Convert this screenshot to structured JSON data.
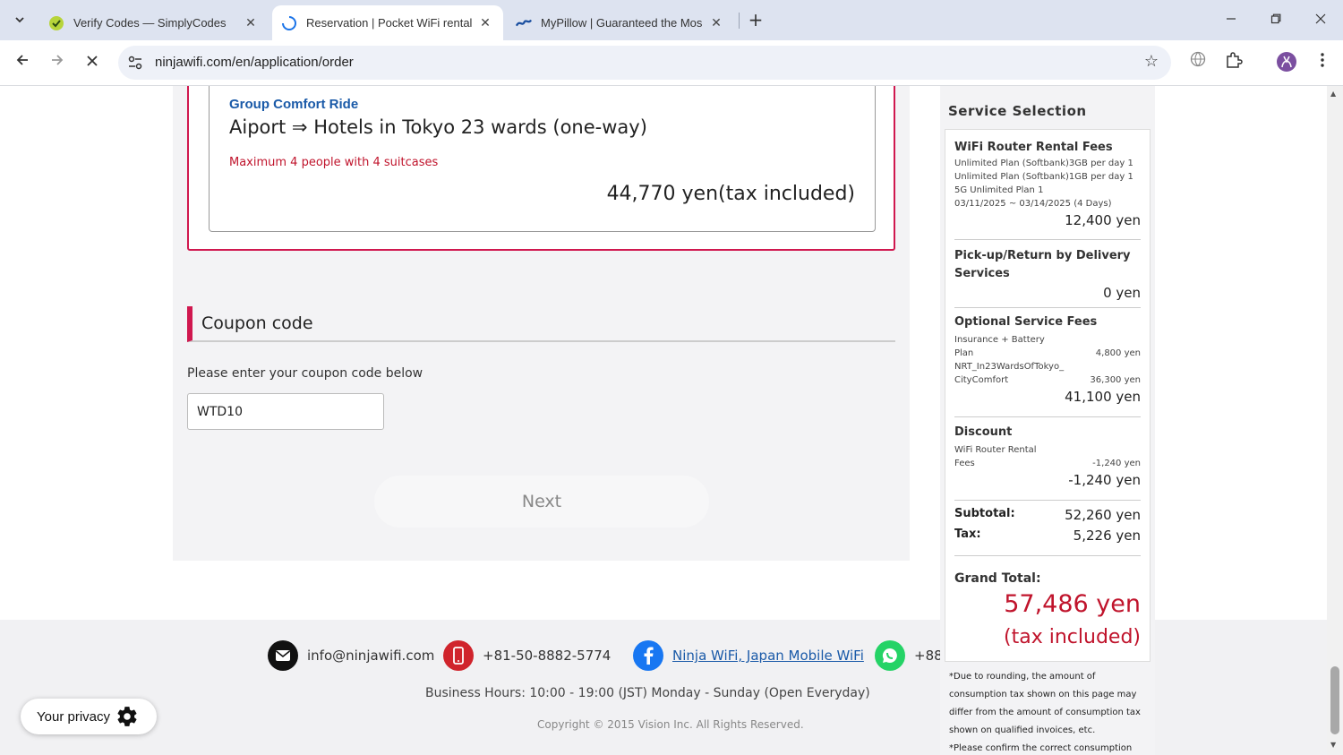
{
  "browser": {
    "tabs": [
      {
        "title": "Verify Codes — SimplyCodes",
        "active": false
      },
      {
        "title": "Reservation | Pocket WiFi rental",
        "active": true
      },
      {
        "title": "MyPillow | Guaranteed the Mos",
        "active": false
      }
    ],
    "url": "ninjawifi.com/en/application/order"
  },
  "option": {
    "title": "Group Comfort Ride",
    "route": "Aiport ⇒ Hotels in Tokyo 23 wards (one-way)",
    "note": "Maximum 4 people with 4 suitcases",
    "price": "44,770 yen(tax included)"
  },
  "coupon": {
    "heading": "Coupon code",
    "label": "Please enter your coupon code below",
    "value": "WTD10",
    "next_label": "Next"
  },
  "footer": {
    "email": "info@ninjawifi.com",
    "phone": "+81-50-8882-5774",
    "facebook": "Ninja WiFi, Japan Mobile WiFi",
    "whatsapp": "+88(",
    "hours": "Business Hours: 10:00 - 19:00 (JST) Monday - Sunday (Open Everyday)",
    "copyright": "Copyright © 2015 Vision Inc. All Rights Reserved."
  },
  "privacy": {
    "label": "Your privacy"
  },
  "summary": {
    "title": "Service Selection",
    "wifi": {
      "heading": "WiFi Router Rental Fees",
      "lines": [
        "Unlimited Plan (Softbank)3GB per day 1",
        "Unlimited Plan (Softbank)1GB per day 1",
        "5G Unlimited Plan 1",
        "03/11/2025 ~ 03/14/2025 (4 Days)"
      ],
      "amount": "12,400 yen"
    },
    "delivery": {
      "heading": "Pick-up/Return by Delivery Services",
      "amount": "0 yen"
    },
    "optional": {
      "heading": "Optional Service Fees",
      "items": [
        {
          "name": "Insurance + Battery Plan",
          "price": "4,800 yen"
        },
        {
          "name": "NRT_In23WardsOfTokyo_CityComfort",
          "price": "36,300 yen"
        }
      ],
      "amount": "41,100 yen"
    },
    "discount": {
      "heading": "Discount",
      "item_name": "WiFi Router Rental Fees",
      "item_price": "-1,240 yen",
      "amount": "-1,240 yen"
    },
    "subtotal_label": "Subtotal:",
    "subtotal": "52,260 yen",
    "tax_label": "Tax:",
    "tax": "5,226 yen",
    "grand_total_label": "Grand Total:",
    "grand_total": "57,486 yen",
    "tax_included": "(tax included)",
    "note_lines": [
      "*Due to rounding, the amount of",
      "consumption tax shown on this page may",
      "differ from the amount of consumption tax",
      "shown on qualified invoices, etc.",
      "*Please confirm the correct consumption"
    ]
  },
  "colors": {
    "accent": "#d0184f",
    "link": "#1a5aa8",
    "price_red": "#c0142c"
  }
}
